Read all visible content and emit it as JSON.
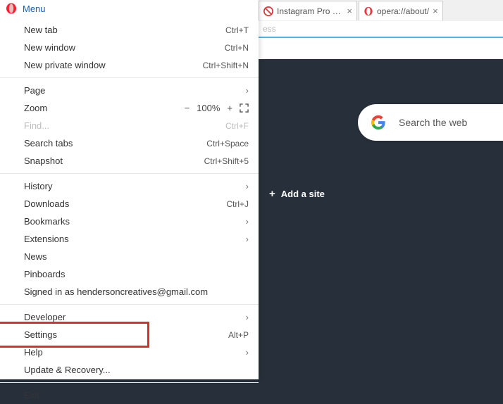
{
  "tabs": [
    {
      "label": "Instagram Pro extens",
      "icon": "instagram-blocked"
    },
    {
      "label": "opera://about/",
      "icon": "opera"
    }
  ],
  "address_hint": "ess",
  "search_placeholder": "Search the web",
  "add_site_label": "Add a site",
  "menu_title": "Menu",
  "zoom": {
    "label": "Zoom",
    "value": "100%",
    "minus": "−",
    "plus": "+"
  },
  "menu": {
    "s1": [
      {
        "label": "New tab",
        "accel": "Ctrl+T"
      },
      {
        "label": "New window",
        "accel": "Ctrl+N"
      },
      {
        "label": "New private window",
        "accel": "Ctrl+Shift+N"
      }
    ],
    "s2": [
      {
        "label": "Page",
        "submenu": true
      },
      {
        "__zoom": true
      },
      {
        "label": "Find...",
        "accel": "Ctrl+F",
        "disabled": true
      },
      {
        "label": "Search tabs",
        "accel": "Ctrl+Space"
      },
      {
        "label": "Snapshot",
        "accel": "Ctrl+Shift+5"
      }
    ],
    "s3": [
      {
        "label": "History",
        "submenu": true
      },
      {
        "label": "Downloads",
        "accel": "Ctrl+J"
      },
      {
        "label": "Bookmarks",
        "submenu": true
      },
      {
        "label": "Extensions",
        "submenu": true
      },
      {
        "label": "News"
      },
      {
        "label": "Pinboards"
      },
      {
        "label": "Signed in as hendersoncreatives@gmail.com"
      }
    ],
    "s4": [
      {
        "label": "Developer",
        "submenu": true
      },
      {
        "label": "Settings",
        "accel": "Alt+P",
        "highlight": true
      },
      {
        "label": "Help",
        "submenu": true
      },
      {
        "label": "Update & Recovery..."
      }
    ],
    "s5": [
      {
        "label": "Exit"
      }
    ]
  }
}
